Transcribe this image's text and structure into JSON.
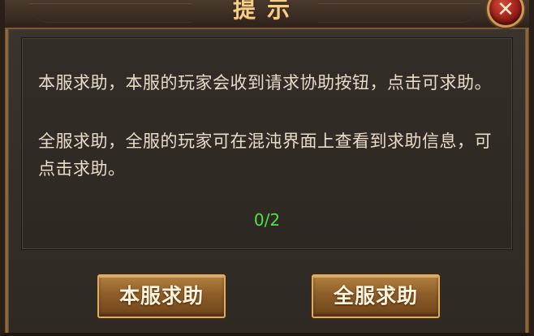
{
  "dialog": {
    "title": "提示",
    "close_icon": "close-icon",
    "paragraphs": {
      "server_help": "本服求助，本服的玩家会收到请求协助按钮，点击可求助。",
      "global_help": "全服求助，全服的玩家可在混沌界面上查看到求助信息，可点击求助。"
    },
    "count": "0/2",
    "count_color": "#4fe04a",
    "buttons": {
      "server_help_label": "本服求助",
      "global_help_label": "全服求助"
    }
  }
}
